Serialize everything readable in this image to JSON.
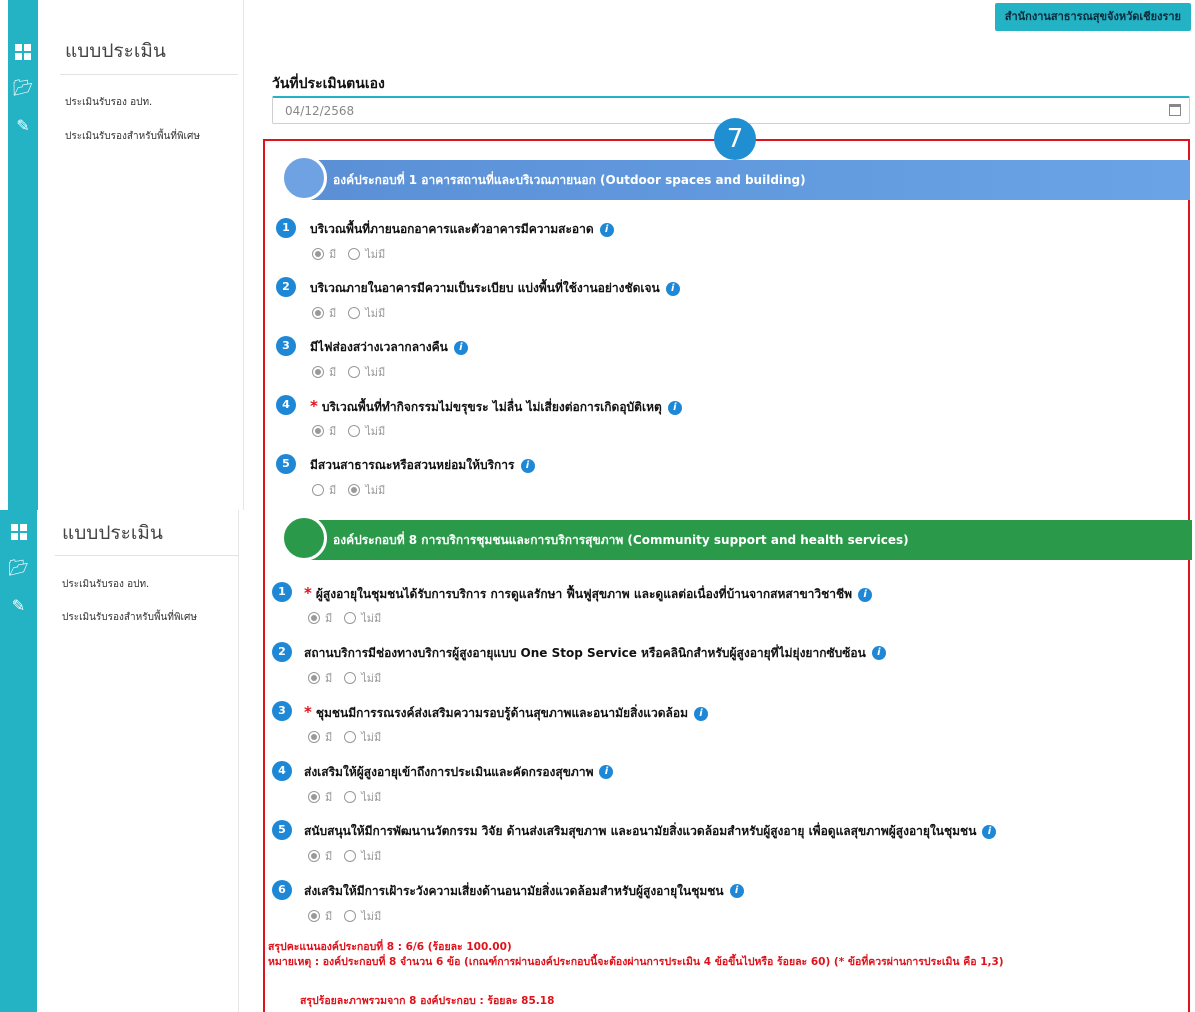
{
  "header": {
    "org_name": "สำนักงานสาธารณสุขจังหวัดเชียงราย"
  },
  "sidebar": {
    "title": "แบบประเมิน",
    "items": [
      {
        "label": "ประเมินรับรอง อปท."
      },
      {
        "label": "ประเมินรับรองสำหรับพื้นที่พิเศษ"
      }
    ]
  },
  "form": {
    "date_label": "วันที่ประเมินตนเอง",
    "date_value": "04/12/2568"
  },
  "callout_number": "7",
  "options": {
    "yes": "มี",
    "no": "ไม่มี"
  },
  "component1": {
    "title": "องค์ประกอบที่ 1 อาคารสถานที่และบริเวณภายนอก (Outdoor spaces and building)",
    "questions": [
      {
        "num": "1",
        "text": "บริเวณพื้นที่ภายนอกอาคารและตัวอาคารมีความสะอาด",
        "required": false,
        "selected": "yes"
      },
      {
        "num": "2",
        "text": "บริเวณภายในอาคารมีความเป็นระเบียบ แบ่งพื้นที่ใช้งานอย่างชัดเจน",
        "required": false,
        "selected": "yes"
      },
      {
        "num": "3",
        "text": "มีไฟส่องสว่างเวลากลางคืน",
        "required": false,
        "selected": "yes"
      },
      {
        "num": "4",
        "text": "บริเวณพื้นที่ทำกิจกรรมไม่ขรุขระ ไม่ลื่น ไม่เสี่ยงต่อการเกิดอุบัติเหตุ",
        "required": true,
        "selected": "yes"
      },
      {
        "num": "5",
        "text": "มีสวนสาธารณะหรือสวนหย่อมให้บริการ",
        "required": false,
        "selected": "no"
      }
    ]
  },
  "component8": {
    "title": "องค์ประกอบที่ 8 การบริการชุมชนและการบริการสุขภาพ (Community support and health services)",
    "questions": [
      {
        "num": "1",
        "text": "ผู้สูงอายุในชุมชนได้รับการบริการ การดูแลรักษา ฟื้นฟูสุขภาพ และดูแลต่อเนื่องที่บ้านจากสหสาขาวิชาชีพ",
        "required": true,
        "selected": "yes"
      },
      {
        "num": "2",
        "text": "สถานบริการมีช่องทางบริการผู้สูงอายุแบบ One Stop Service หรือคลินิกสำหรับผู้สูงอายุที่ไม่ยุ่งยากซับซ้อน",
        "required": false,
        "selected": "yes"
      },
      {
        "num": "3",
        "text": "ชุมชนมีการรณรงค์ส่งเสริมความรอบรู้ด้านสุขภาพและอนามัยสิ่งแวดล้อม",
        "required": true,
        "selected": "yes"
      },
      {
        "num": "4",
        "text": "ส่งเสริมให้ผู้สูงอายุเข้าถึงการประเมินและคัดกรองสุขภาพ",
        "required": false,
        "selected": "yes"
      },
      {
        "num": "5",
        "text": "สนับสนุนให้มีการพัฒนานวัตกรรม วิจัย ด้านส่งเสริมสุขภาพ และอนามัยสิ่งแวดล้อมสำหรับผู้สูงอายุ เพื่อดูแลสุขภาพผู้สูงอายุในชุมชน",
        "required": false,
        "selected": "yes"
      },
      {
        "num": "6",
        "text": "ส่งเสริมให้มีการเฝ้าระวังความเสี่ยงด้านอนามัยสิ่งแวดล้อมสำหรับผู้สูงอายุในชุมชน",
        "required": false,
        "selected": "yes"
      }
    ],
    "score_summary": "สรุปคะแนนองค์ประกอบที่ 8 : 6/6 (ร้อยละ 100.00)",
    "note": "หมายเหตุ : องค์ประกอบที่ 8 จำนวน 6 ข้อ (เกณฑ์การผ่านองค์ประกอบนี้จะต้องผ่านการประเมิน 4 ข้อขึ้นไปหรือ ร้อยละ 60) (* ข้อที่ควรผ่านการประเมิน คือ 1,3)"
  },
  "overall_summary": "สรุปร้อยละภาพรวมจาก 8 องค์ประกอบ : ร้อยละ 85.18",
  "colors": {
    "accent": "#24b3c5",
    "component1": "#5a8fd6",
    "component8": "#2a9a4a",
    "highlight": "#e0121b",
    "number": "#1e88d6"
  }
}
